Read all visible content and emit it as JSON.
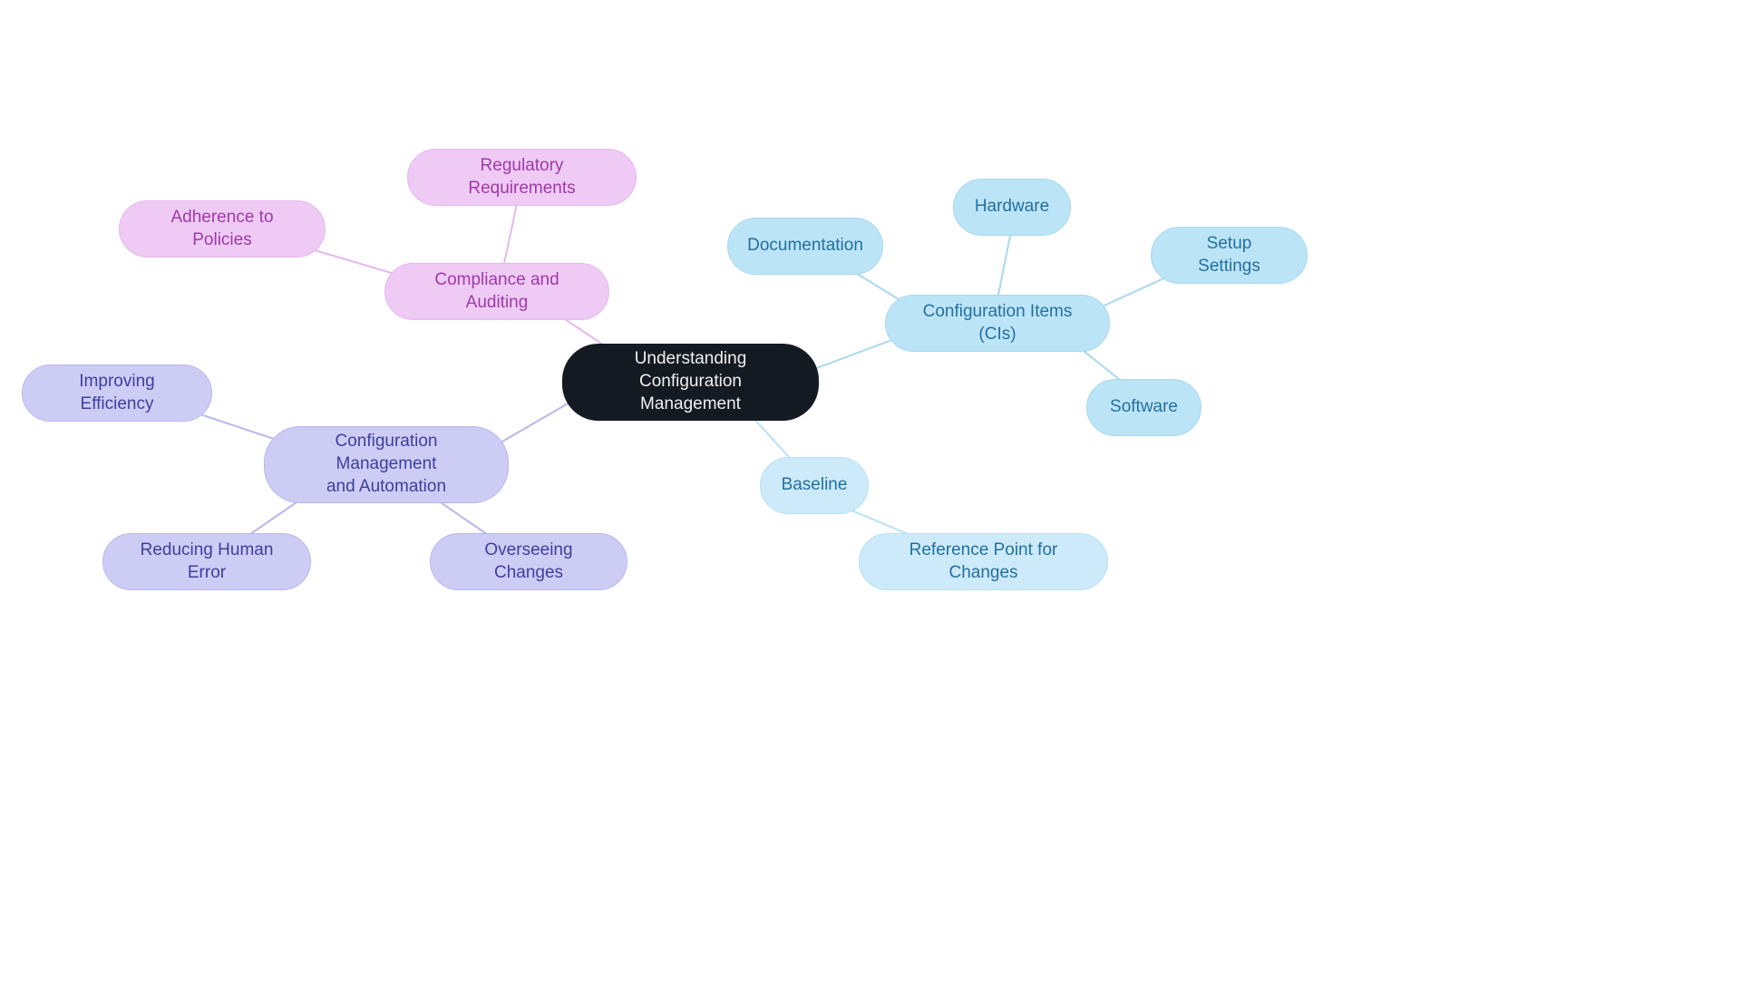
{
  "center": {
    "label": "Understanding Configuration\nManagement"
  },
  "branches": {
    "configItems": {
      "label": "Configuration Items (CIs)",
      "children": {
        "documentation": "Documentation",
        "hardware": "Hardware",
        "setupSettings": "Setup Settings",
        "software": "Software"
      }
    },
    "baseline": {
      "label": "Baseline",
      "children": {
        "referencePoint": "Reference Point for Changes"
      }
    },
    "automation": {
      "label": "Configuration Management\nand Automation",
      "children": {
        "efficiency": "Improving Efficiency",
        "humanError": "Reducing Human Error",
        "overseeing": "Overseeing Changes"
      }
    },
    "compliance": {
      "label": "Compliance and Auditing",
      "children": {
        "adherence": "Adherence to Policies",
        "regulatory": "Regulatory Requirements"
      }
    }
  },
  "colors": {
    "center": "#141a22",
    "blue": "#bce4f7",
    "lightblue": "#cdeafa",
    "purple": "#cdccf5",
    "pink": "#eecaf5"
  }
}
